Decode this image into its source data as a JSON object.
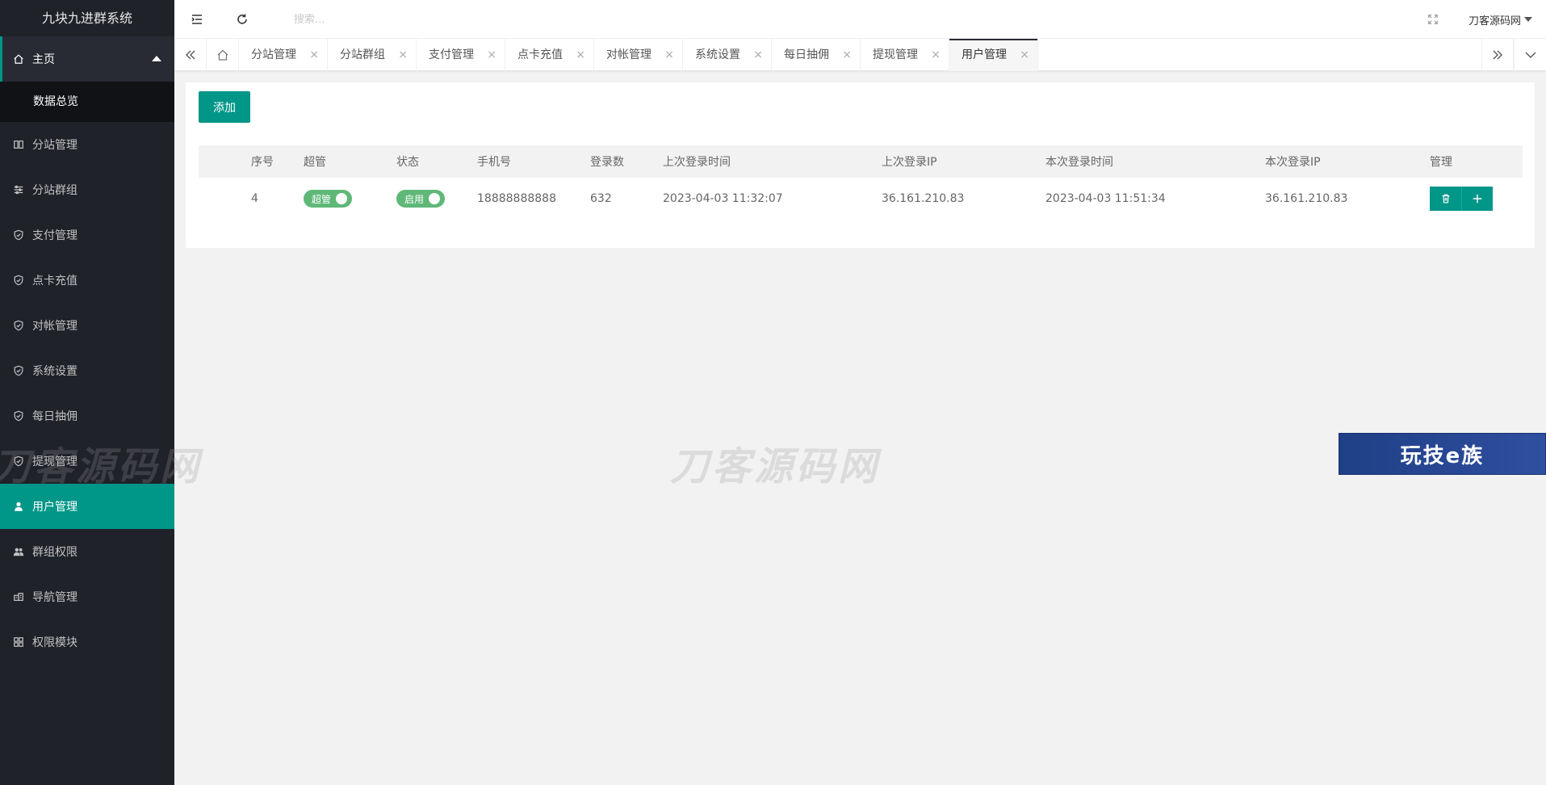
{
  "app_title": "九块九进群系统",
  "header": {
    "search_placeholder": "搜索...",
    "user_name": "刀客源码网"
  },
  "sidebar": {
    "home_label": "主页",
    "home_sub": "数据总览",
    "items": [
      {
        "label": "分站管理",
        "icon": "columns-icon"
      },
      {
        "label": "分站群组",
        "icon": "sliders-icon"
      },
      {
        "label": "支付管理",
        "icon": "shield-icon"
      },
      {
        "label": "点卡充值",
        "icon": "shield-icon"
      },
      {
        "label": "对帐管理",
        "icon": "shield-icon"
      },
      {
        "label": "系统设置",
        "icon": "shield-icon"
      },
      {
        "label": "每日抽佣",
        "icon": "shield-icon"
      },
      {
        "label": "提现管理",
        "icon": "shield-icon"
      },
      {
        "label": "用户管理",
        "icon": "user-icon"
      },
      {
        "label": "群组权限",
        "icon": "users-icon"
      },
      {
        "label": "导航管理",
        "icon": "nav-icon"
      },
      {
        "label": "权限模块",
        "icon": "grid-icon"
      }
    ]
  },
  "tabs": [
    {
      "label": "分站管理"
    },
    {
      "label": "分站群组"
    },
    {
      "label": "支付管理"
    },
    {
      "label": "点卡充值"
    },
    {
      "label": "对帐管理"
    },
    {
      "label": "系统设置"
    },
    {
      "label": "每日抽佣"
    },
    {
      "label": "提现管理"
    },
    {
      "label": "用户管理"
    }
  ],
  "tab_close_glyph": "×",
  "content": {
    "add_label": "添加",
    "columns": [
      "序号",
      "超管",
      "状态",
      "手机号",
      "登录数",
      "上次登录时间",
      "上次登录IP",
      "本次登录时间",
      "本次登录IP",
      "管理"
    ],
    "rows": [
      {
        "id": "4",
        "super_label": "超管",
        "status_label": "启用",
        "phone": "18888888888",
        "logins": "632",
        "last_time": "2023-04-03 11:32:07",
        "last_ip": "36.161.210.83",
        "cur_time": "2023-04-03 11:51:34",
        "cur_ip": "36.161.210.83"
      }
    ]
  },
  "watermarks": {
    "text": "刀客源码网",
    "badge": "玩技e族"
  },
  "colors": {
    "accent": "#009688",
    "sidebar_bg": "#20222a",
    "switch_on": "#5fb878"
  }
}
